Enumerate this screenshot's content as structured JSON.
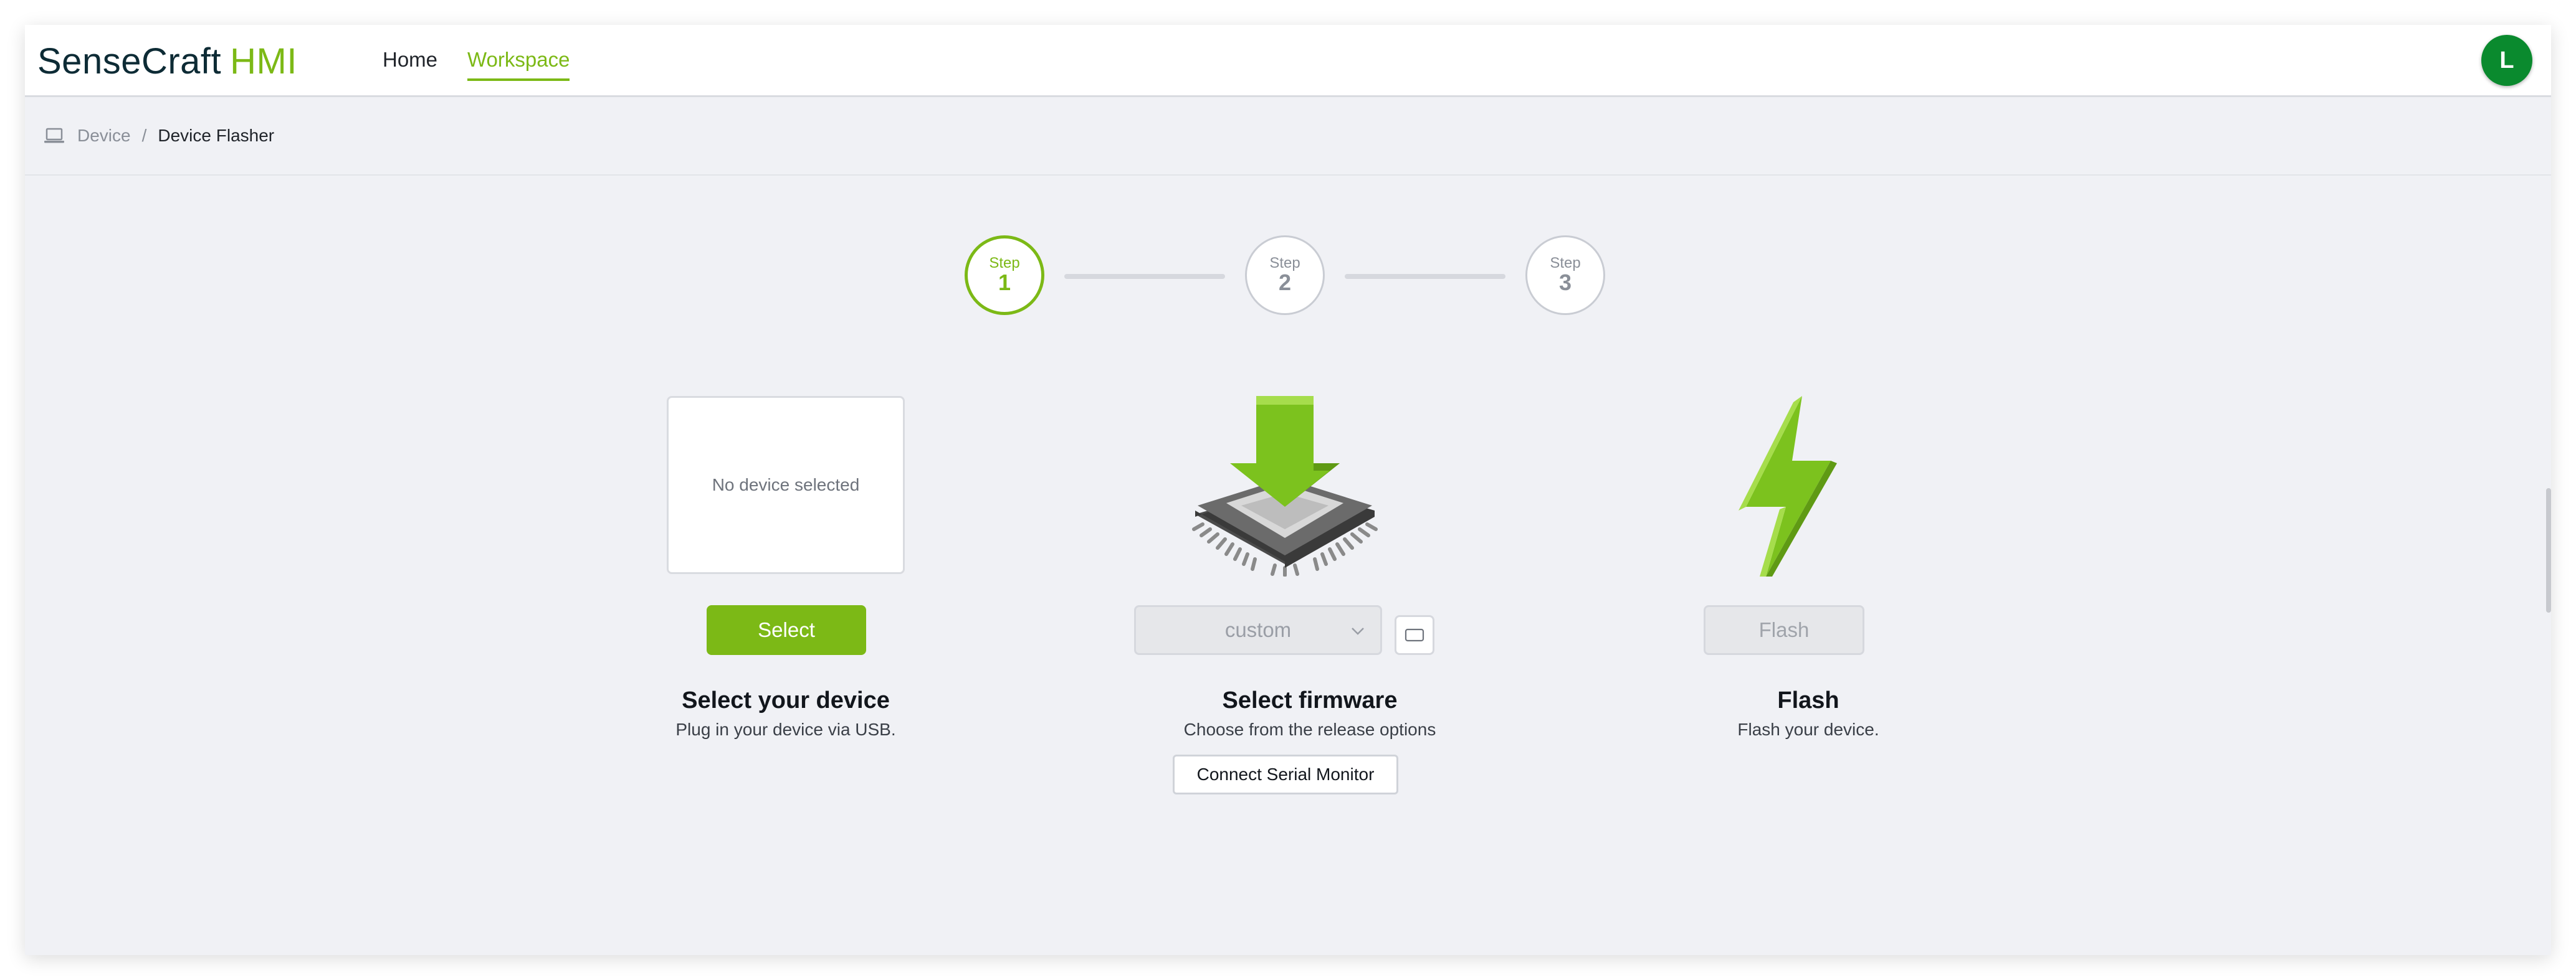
{
  "header": {
    "logo_brand": "SenseCraft",
    "logo_accent": "HMI",
    "nav": [
      {
        "label": "Home",
        "active": false
      },
      {
        "label": "Workspace",
        "active": true
      }
    ],
    "avatar_initial": "L"
  },
  "breadcrumb": {
    "items": [
      "Device",
      "Device Flasher"
    ],
    "separator": "/"
  },
  "steps": [
    {
      "word": "Step",
      "number": "1",
      "active": true
    },
    {
      "word": "Step",
      "number": "2",
      "active": false
    },
    {
      "word": "Step",
      "number": "3",
      "active": false
    }
  ],
  "device_panel": {
    "placeholder": "No device selected",
    "button_label": "Select",
    "title": "Select your device",
    "subtitle": "Plug in your device via USB."
  },
  "firmware_panel": {
    "select_value": "custom",
    "title": "Select firmware",
    "subtitle": "Choose from the release options",
    "serial_button_label": "Connect Serial Monitor"
  },
  "flash_panel": {
    "button_label": "Flash",
    "title": "Flash",
    "subtitle": "Flash your device."
  },
  "colors": {
    "accent": "#7cb916",
    "avatar": "#0a8a2e",
    "brand_text": "#0d2b35"
  },
  "icons": {
    "breadcrumb": "laptop-icon",
    "firmware": "chip-download-icon",
    "flash": "lightning-bolt-icon",
    "select_chevron": "chevron-down-icon",
    "small_button": "terminal-icon"
  }
}
